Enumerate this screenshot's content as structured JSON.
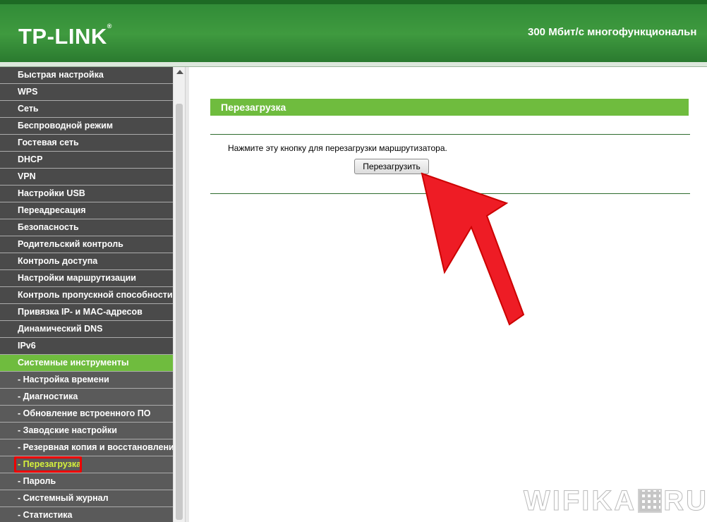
{
  "header": {
    "logo_text": "TP-LINK",
    "logo_mark": "®",
    "model_text": "300 Мбит/с многофункциональн"
  },
  "sidebar": {
    "items": [
      {
        "label": "Быстрая настройка",
        "type": "top"
      },
      {
        "label": "WPS",
        "type": "top"
      },
      {
        "label": "Сеть",
        "type": "top"
      },
      {
        "label": "Беспроводной режим",
        "type": "top"
      },
      {
        "label": "Гостевая сеть",
        "type": "top"
      },
      {
        "label": "DHCP",
        "type": "top"
      },
      {
        "label": "VPN",
        "type": "top"
      },
      {
        "label": "Настройки USB",
        "type": "top"
      },
      {
        "label": "Переадресация",
        "type": "top"
      },
      {
        "label": "Безопасность",
        "type": "top"
      },
      {
        "label": "Родительский контроль",
        "type": "top"
      },
      {
        "label": "Контроль доступа",
        "type": "top"
      },
      {
        "label": "Настройки маршрутизации",
        "type": "top"
      },
      {
        "label": "Контроль пропускной способности",
        "type": "top"
      },
      {
        "label": "Привязка IP- и MAC-адресов",
        "type": "top"
      },
      {
        "label": "Динамический DNS",
        "type": "top"
      },
      {
        "label": "IPv6",
        "type": "top"
      },
      {
        "label": "Системные инструменты",
        "type": "active"
      },
      {
        "label": "- Настройка времени",
        "type": "sub"
      },
      {
        "label": "- Диагностика",
        "type": "sub"
      },
      {
        "label": "- Обновление встроенного ПО",
        "type": "sub"
      },
      {
        "label": "- Заводские настройки",
        "type": "sub"
      },
      {
        "label": "- Резервная копия и восстановление",
        "type": "sub"
      },
      {
        "label": "- Перезагрузка",
        "type": "current"
      },
      {
        "label": "- Пароль",
        "type": "sub"
      },
      {
        "label": "- Системный журнал",
        "type": "sub"
      },
      {
        "label": "- Статистика",
        "type": "sub"
      }
    ]
  },
  "main": {
    "section_title": "Перезагрузка",
    "description": "Нажмите эту кнопку для перезагрузки маршрутизатора.",
    "reboot_button_label": "Перезагрузить"
  },
  "watermark": {
    "left": "WIFIKA",
    "right": "RU"
  },
  "colors": {
    "brand_green": "#6fbc3e",
    "header_green": "#3f9a3f",
    "sidebar_bg": "#4a4a4a",
    "annotation_red": "#e00000",
    "current_item_text": "#d5f23c"
  }
}
